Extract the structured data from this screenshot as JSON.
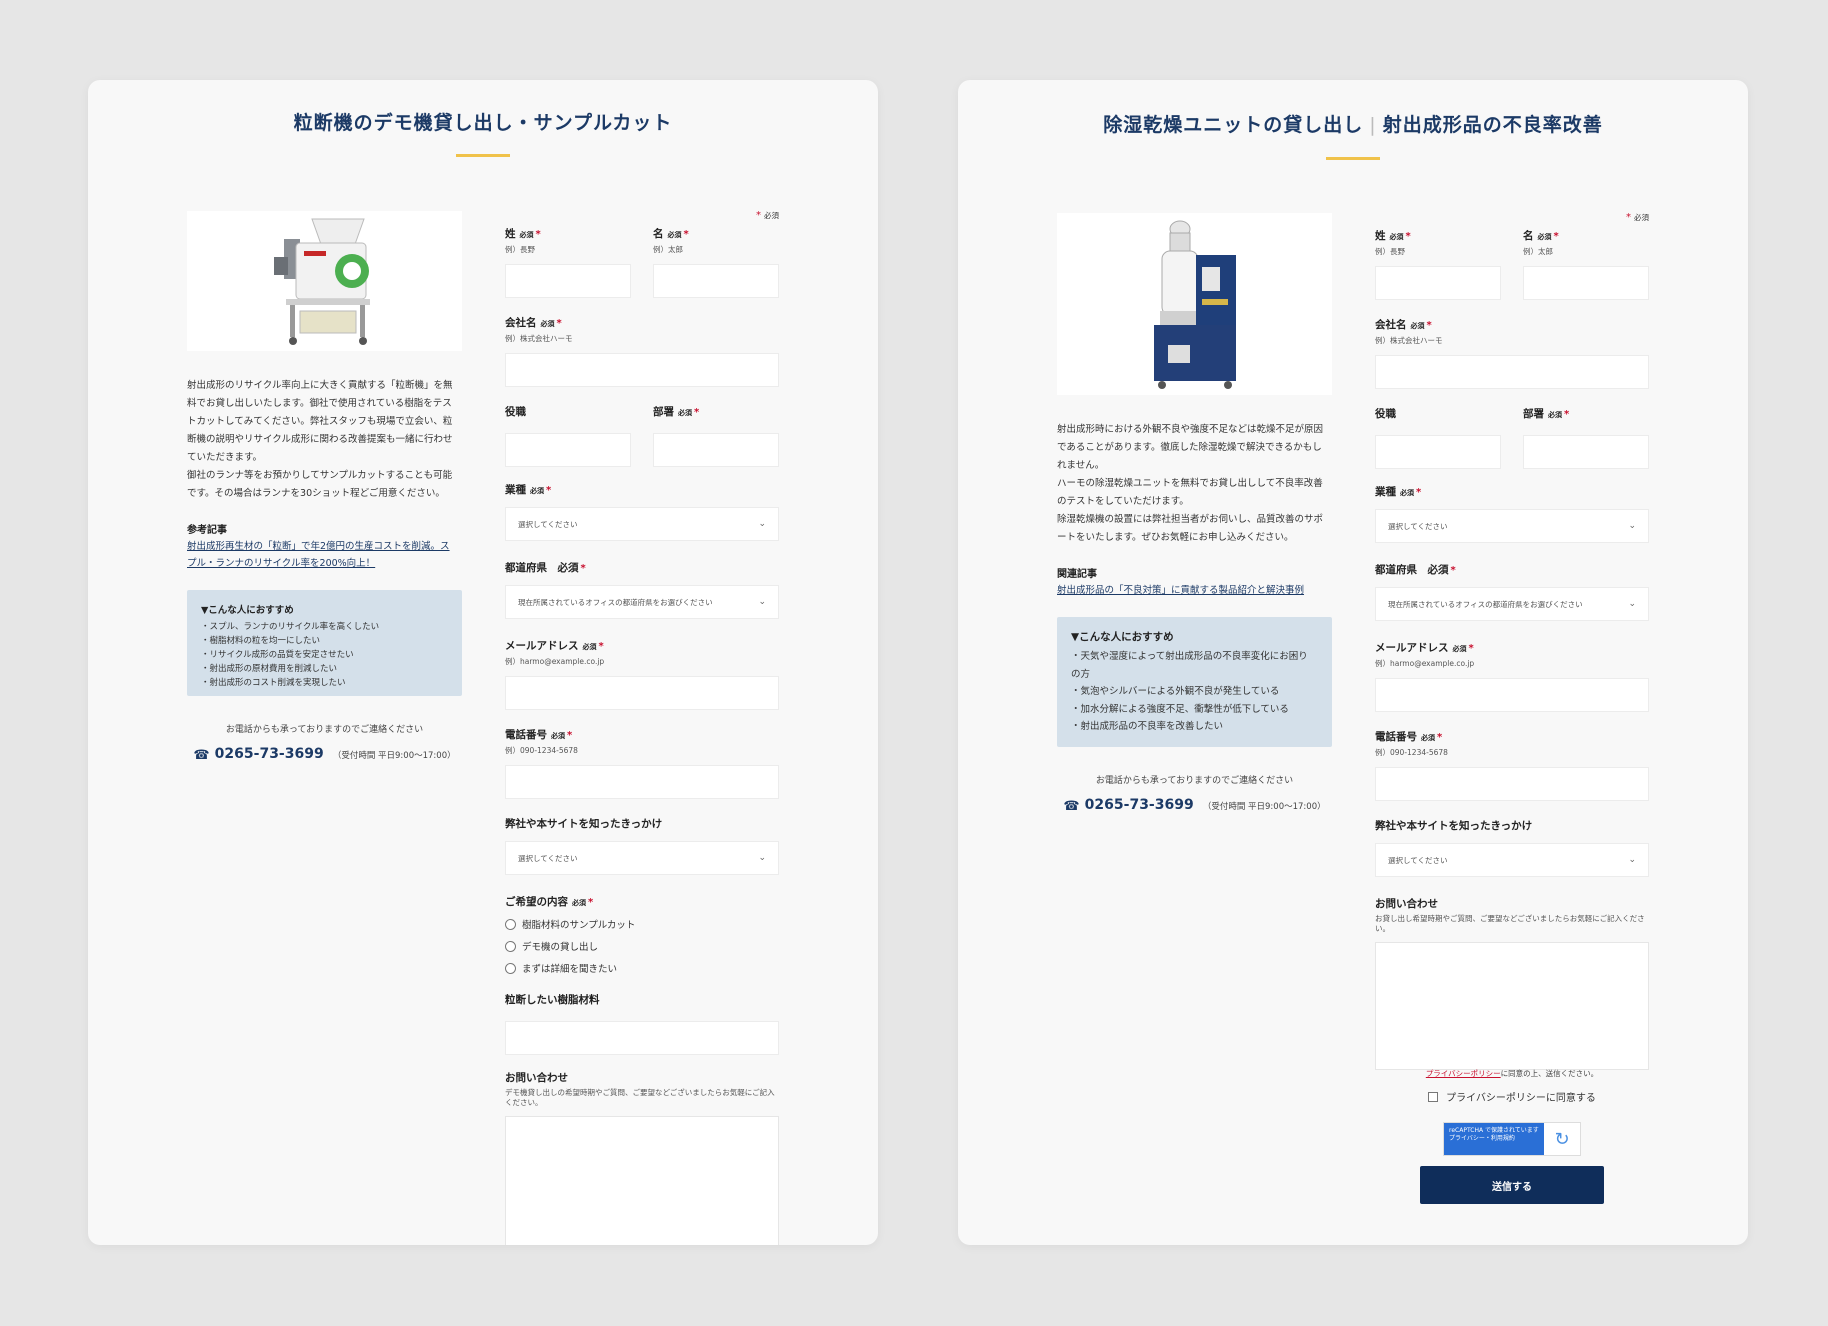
{
  "common": {
    "required_badge": "必須",
    "required_legend": "必須",
    "star": "*",
    "phone_icon": "phone-icon",
    "chevron_icon": "chevron-down-icon"
  },
  "left": {
    "title": "粒断機のデモ機貸し出し・サンプルカット",
    "desc": [
      "射出成形のリサイクル率向上に大きく貢献する「粒断機」を無",
      "料でお貸し出しいたします。御社で使用されている樹脂をテス",
      "トカットしてみてください。弊社スタッフも現場で立会い、粒",
      "断機の説明やリサイクル成形に関わる改善提案も一緒に行わせ",
      "ていただきます。",
      "御社のランナ等をお預かりしてサンプルカットすることも可能",
      "です。その場合はランナを30ショット程どご用意ください。"
    ],
    "ref_heading": "参考記事",
    "ref_link": [
      "射出成形再生材の「粒断」で年2億円の生産コストを削減。ス",
      "プル・ランナのリサイクル率を200%向上！"
    ],
    "rec_title": "▼こんな人におすすめ",
    "rec_items": [
      "・スプル、ランナのリサイクル率を高くしたい",
      "・樹脂材料の粒を均一にしたい",
      "・リサイクル成形の品質を安定させたい",
      "・射出成形の原材費用を削減したい",
      "・射出成形のコスト削減を実現したい"
    ],
    "contact_note": "お電話からも承っておりますのでご連絡ください",
    "phone": "0265-73-3699",
    "hours": "（受付時間 平日9:00〜17:00）",
    "form": {
      "last_name": {
        "label": "姓",
        "hint": "例）長野"
      },
      "first_name": {
        "label": "名",
        "hint": "例）太郎"
      },
      "company": {
        "label": "会社名",
        "hint": "例）株式会社ハーモ"
      },
      "position": {
        "label": "役職"
      },
      "department": {
        "label": "部署"
      },
      "industry": {
        "label": "業種",
        "placeholder": "選択してください"
      },
      "prefecture": {
        "label": "都道府県　必須",
        "placeholder": "現在所属されているオフィスの都道府県をお選びください"
      },
      "email": {
        "label": "メールアドレス",
        "hint": "例）harmo@example.co.jp"
      },
      "tel": {
        "label": "電話番号",
        "hint": "例）090-1234-5678"
      },
      "source": {
        "label": "弊社や本サイトを知ったきっかけ",
        "placeholder": "選択してください"
      },
      "request": {
        "label": "ご希望の内容",
        "options": [
          "樹脂材料のサンプルカット",
          "デモ機の貸し出し",
          "まずは詳細を聞きたい"
        ]
      },
      "material": {
        "label": "粒断したい樹脂材料"
      },
      "inquiry": {
        "label": "お問い合わせ",
        "hint": "デモ機貸し出しの希望時期やご質問、ご要望などございましたらお気軽にご記入ください。"
      }
    }
  },
  "right": {
    "title_a": "除湿乾燥ユニットの貸し出し",
    "title_sep": "|",
    "title_b": "射出成形品の不良率改善",
    "desc": [
      "射出成形時における外観不良や強度不足などは乾燥不足が原因",
      "であることがあります。徹底した除湿乾燥で解決できるかもし",
      "れません。",
      "ハーモの除湿乾燥ユニットを無料でお貸し出しして不良率改善",
      "のテストをしていただけます。",
      "除湿乾燥機の設置には弊社担当者がお伺いし、品質改善のサポ",
      "ートをいたします。ぜひお気軽にお申し込みください。"
    ],
    "ref_heading": "関連記事",
    "ref_link": [
      "射出成形品の「不良対策」に貢献する製品紹介と解決事例"
    ],
    "rec_title": "▼こんな人におすすめ",
    "rec_items": [
      "・天気や湿度によって射出成形品の不良率変化にお困り",
      "の方",
      "・気泡やシルバーによる外観不良が発生している",
      "・加水分解による強度不足、衝撃性が低下している",
      "・射出成形品の不良率を改善したい"
    ],
    "contact_note": "お電話からも承っておりますのでご連絡ください",
    "phone": "0265-73-3699",
    "hours": "（受付時間 平日9:00〜17:00）",
    "form": {
      "last_name": {
        "label": "姓",
        "hint": "例）長野"
      },
      "first_name": {
        "label": "名",
        "hint": "例）太郎"
      },
      "company": {
        "label": "会社名",
        "hint": "例）株式会社ハーモ"
      },
      "position": {
        "label": "役職"
      },
      "department": {
        "label": "部署"
      },
      "industry": {
        "label": "業種",
        "placeholder": "選択してください"
      },
      "prefecture": {
        "label": "都道府県　必須",
        "placeholder": "現在所属されているオフィスの都道府県をお選びください"
      },
      "email": {
        "label": "メールアドレス",
        "hint": "例）harmo@example.co.jp"
      },
      "tel": {
        "label": "電話番号",
        "hint": "例）090-1234-5678"
      },
      "source": {
        "label": "弊社や本サイトを知ったきっかけ",
        "placeholder": "選択してください"
      },
      "inquiry": {
        "label": "お問い合わせ",
        "hint": "お貸し出し希望時期やご質問、ご要望などございましたらお気軽にご記入ください。"
      }
    },
    "privacy_link": "プライバシーポリシー",
    "privacy_note": "に同意の上、送信ください。",
    "privacy_check": "プライバシーポリシーに同意する",
    "recaptcha_text": "reCAPTCHA で保護されています",
    "recaptcha_sub": "プライバシー・利用規約",
    "submit": "送信する"
  }
}
